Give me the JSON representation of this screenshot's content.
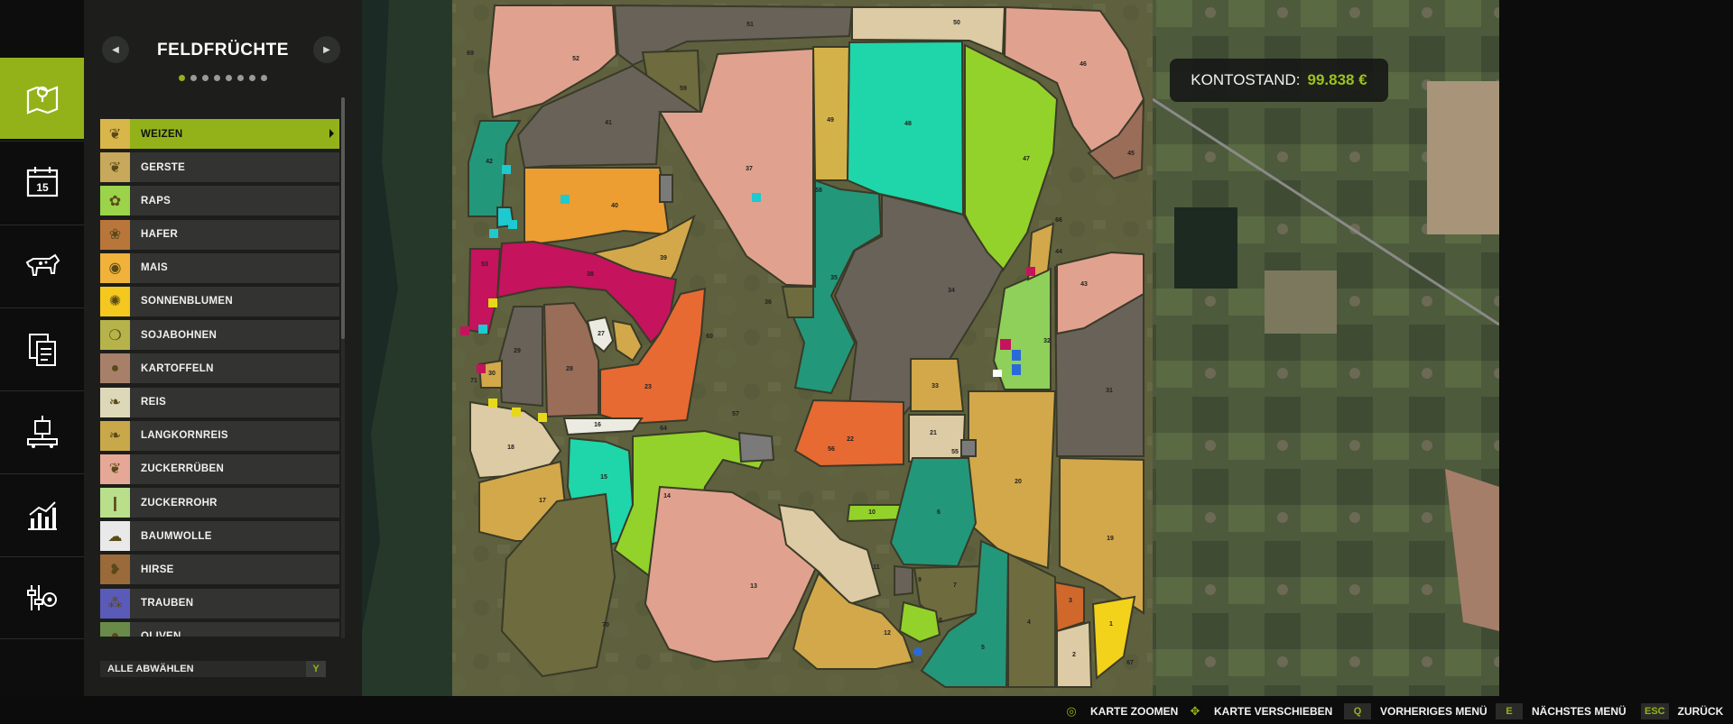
{
  "panel": {
    "title": "FELDFRÜCHTE",
    "page_count": 8,
    "active_page": 0,
    "crops": [
      {
        "label": "WEIZEN",
        "icon": "wheat-icon",
        "color": "#d9b64a",
        "selected": true
      },
      {
        "label": "GERSTE",
        "icon": "barley-icon",
        "color": "#c8a85a"
      },
      {
        "label": "RAPS",
        "icon": "canola-icon",
        "color": "#9bd34a"
      },
      {
        "label": "HAFER",
        "icon": "oat-icon",
        "color": "#b8763a"
      },
      {
        "label": "MAIS",
        "icon": "maize-icon",
        "color": "#f0b23a"
      },
      {
        "label": "SONNENBLUMEN",
        "icon": "sunflower-icon",
        "color": "#f4c81e"
      },
      {
        "label": "SOJABOHNEN",
        "icon": "soybean-icon",
        "color": "#b6b34a"
      },
      {
        "label": "KARTOFFELN",
        "icon": "potato-icon",
        "color": "#a8806a"
      },
      {
        "label": "REIS",
        "icon": "rice-icon",
        "color": "#ddd9b8"
      },
      {
        "label": "LANGKORNREIS",
        "icon": "longgrain-rice-icon",
        "color": "#c9a84a"
      },
      {
        "label": "ZUCKERRÜBEN",
        "icon": "sugarbeet-icon",
        "color": "#e6a896"
      },
      {
        "label": "ZUCKERROHR",
        "icon": "sugarcane-icon",
        "color": "#b9df8a"
      },
      {
        "label": "BAUMWOLLE",
        "icon": "cotton-icon",
        "color": "#e9e9e9"
      },
      {
        "label": "HIRSE",
        "icon": "sorghum-icon",
        "color": "#9a6a3a"
      },
      {
        "label": "TRAUBEN",
        "icon": "grapes-icon",
        "color": "#5a5ab8"
      },
      {
        "label": "OLIVEN",
        "icon": "olive-icon",
        "color": "#6a8a4a"
      }
    ],
    "deselect_label": "ALLE ABWÄHLEN",
    "deselect_key": "Y"
  },
  "balance": {
    "label": "KONTOSTAND:",
    "value": "99.838 €"
  },
  "map": {
    "fields": [
      "1",
      "2",
      "3",
      "4",
      "5",
      "7",
      "8",
      "9",
      "10",
      "11",
      "12",
      "13",
      "14",
      "15",
      "16",
      "17",
      "18",
      "19",
      "20",
      "21",
      "22",
      "23",
      "25",
      "26",
      "27",
      "28",
      "29",
      "30",
      "31",
      "32",
      "33",
      "34",
      "35",
      "36",
      "37",
      "38",
      "39",
      "40",
      "41",
      "42",
      "43",
      "44",
      "45",
      "46",
      "47",
      "48",
      "49",
      "50",
      "51",
      "52",
      "53",
      "55",
      "56",
      "57",
      "58",
      "59",
      "60",
      "64",
      "66",
      "67",
      "69",
      "70",
      "71"
    ]
  },
  "bottom_hints": [
    {
      "key": "zoom-icon",
      "label": "KARTE ZOOMEN"
    },
    {
      "key": "move-icon",
      "label": "KARTE VERSCHIEBEN"
    },
    {
      "key": "Q",
      "label": "VORHERIGES MENÜ"
    },
    {
      "key": "E",
      "label": "NÄCHSTES MENÜ"
    },
    {
      "key": "ESC",
      "label": "ZURÜCK"
    }
  ]
}
